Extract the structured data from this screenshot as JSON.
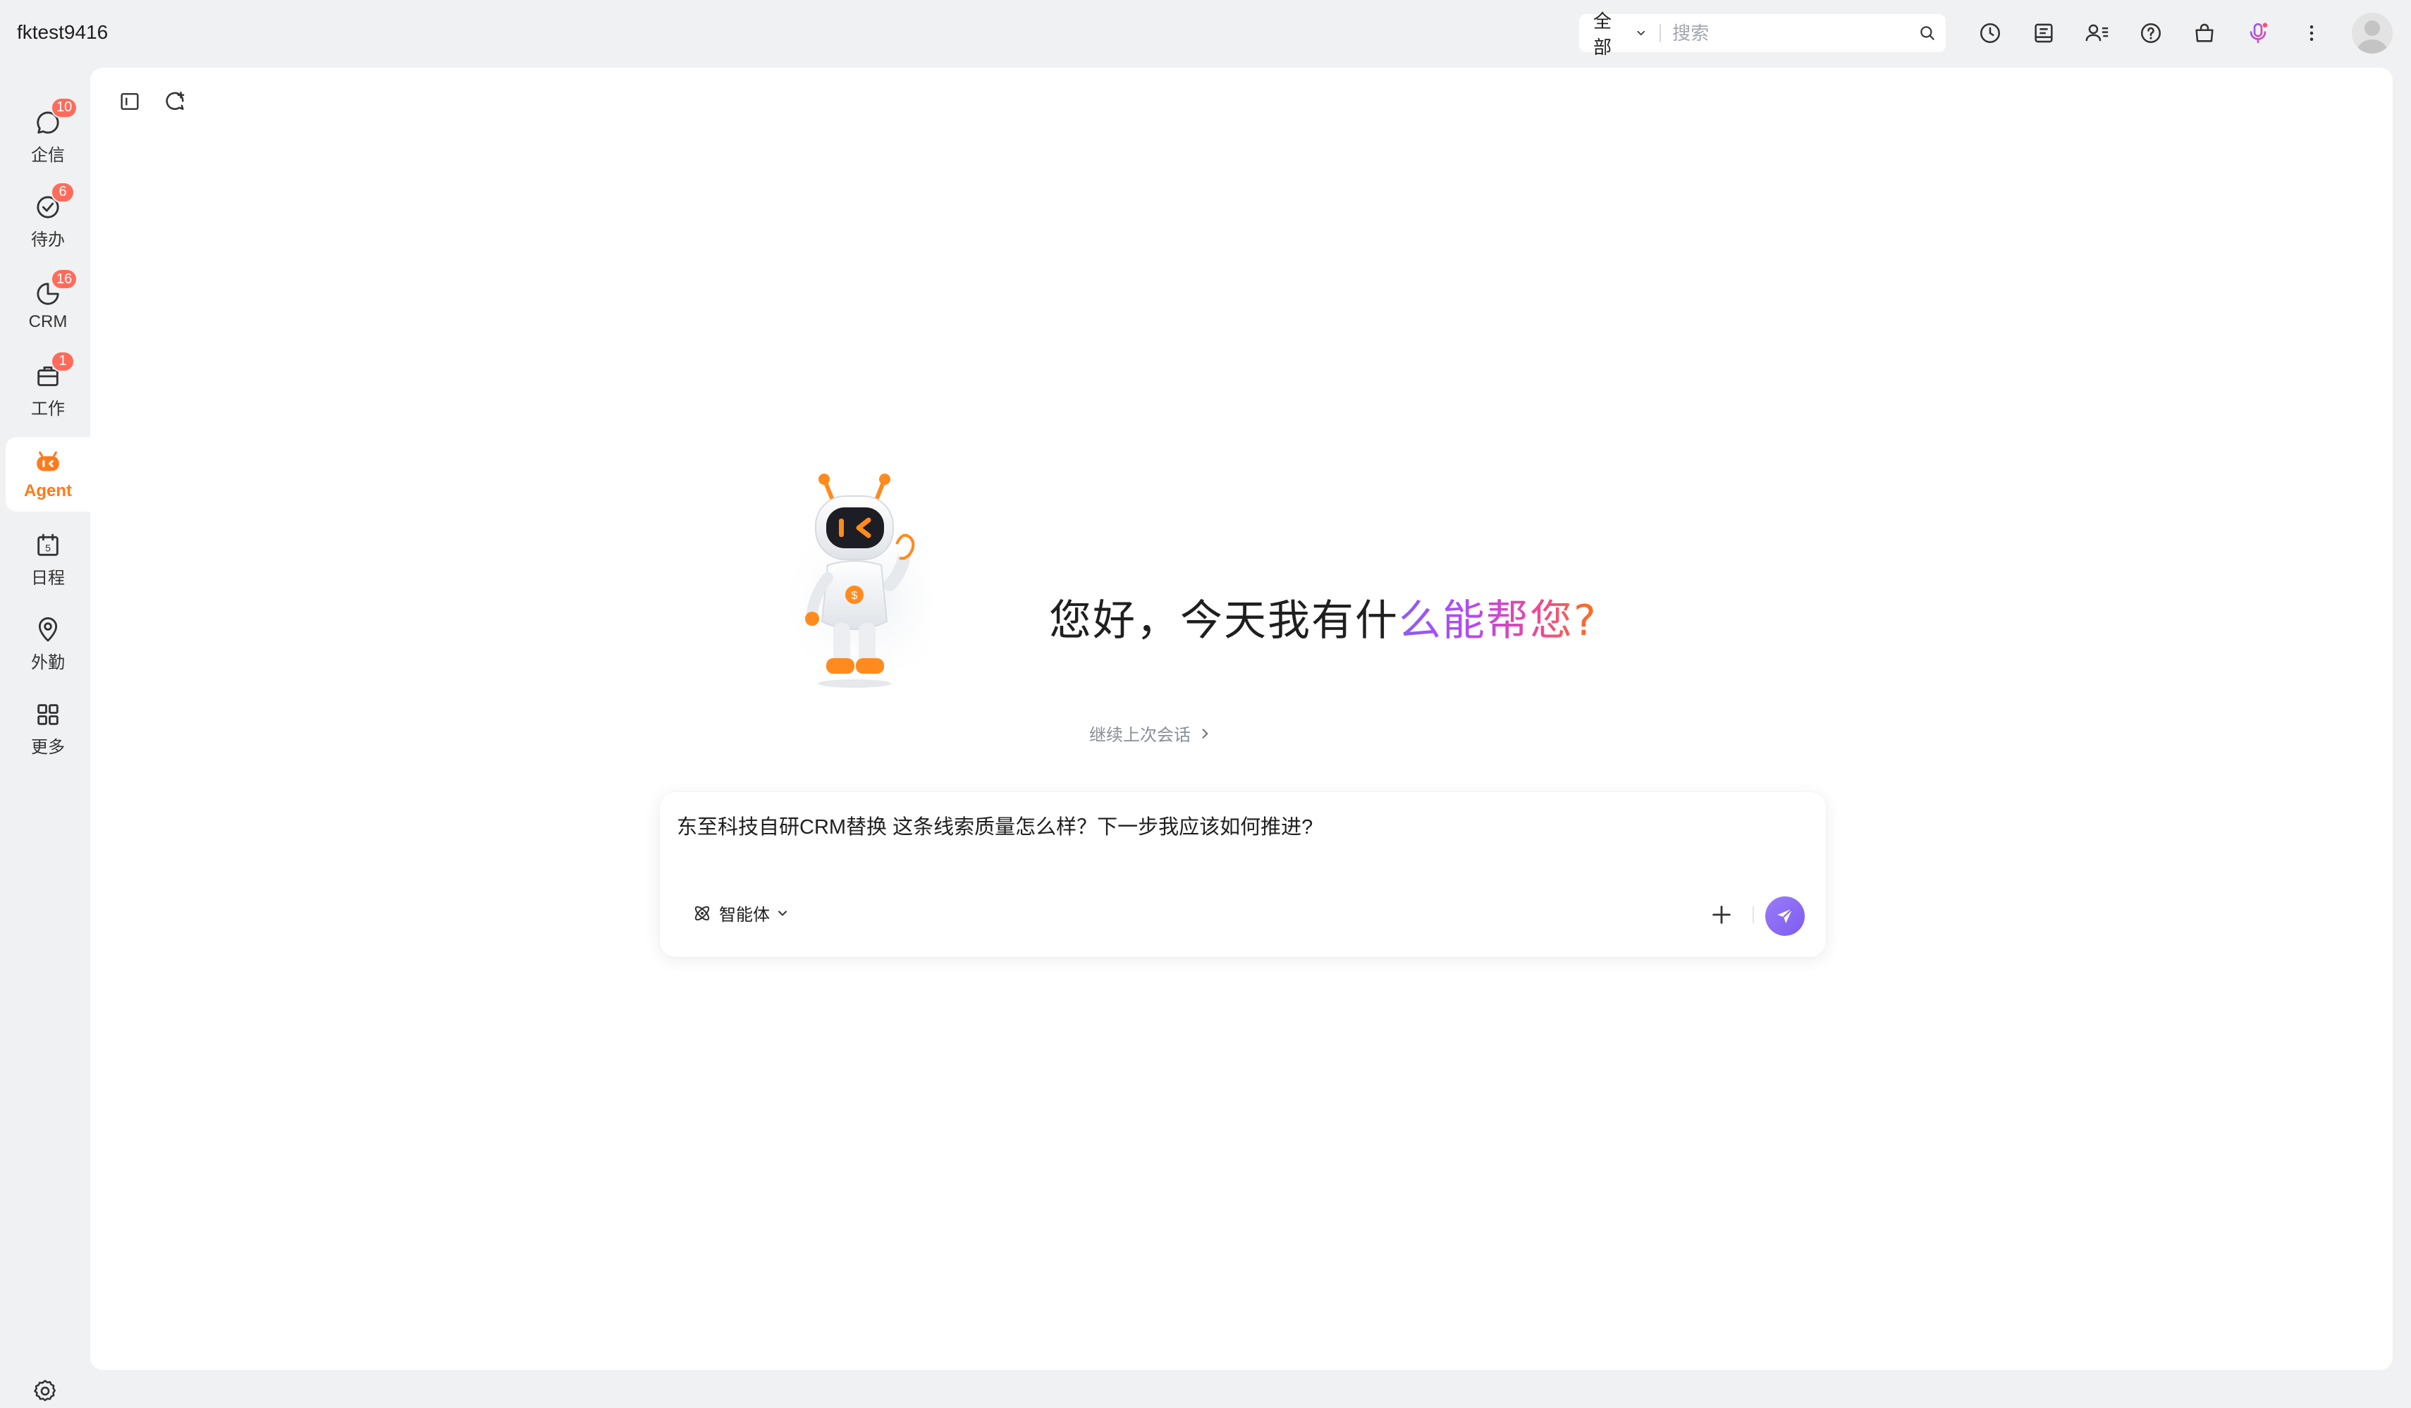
{
  "app": {
    "account_name": "fktest9416"
  },
  "search": {
    "scope": "全部",
    "placeholder": "搜索"
  },
  "top_icons": [
    "history-icon",
    "notes-icon",
    "contacts-icon",
    "help-icon",
    "shop-icon",
    "ai-voice-icon",
    "more-vertical-icon"
  ],
  "nav": {
    "items": [
      {
        "label": "企信",
        "badge": "10",
        "icon": "chat-icon"
      },
      {
        "label": "待办",
        "badge": "6",
        "icon": "todo-check-icon"
      },
      {
        "label": "CRM",
        "badge": "16",
        "icon": "crm-pie-icon"
      },
      {
        "label": "工作",
        "badge": "1",
        "icon": "work-briefcase-icon"
      },
      {
        "label": "Agent",
        "badge": "",
        "icon": "agent-robot-icon"
      },
      {
        "label": "日程",
        "badge": "",
        "icon": "calendar-icon"
      },
      {
        "label": "外勤",
        "badge": "",
        "icon": "location-pin-icon"
      },
      {
        "label": "更多",
        "badge": "",
        "icon": "grid-more-icon"
      }
    ],
    "active": "Agent"
  },
  "main": {
    "greeting_plain": "您好，今天我有什",
    "greeting_highlight": "么能帮您?",
    "continue_label": "继续上次会话",
    "composer_text": "东至科技自研CRM替换 这条线索质量怎么样？下一步我应该如何推进?",
    "agent_selector_label": "智能体"
  },
  "colors": {
    "accent_orange": "#ff7a1a",
    "badge_red": "#ff6b5b",
    "send_purple": "#7c5cf0"
  }
}
